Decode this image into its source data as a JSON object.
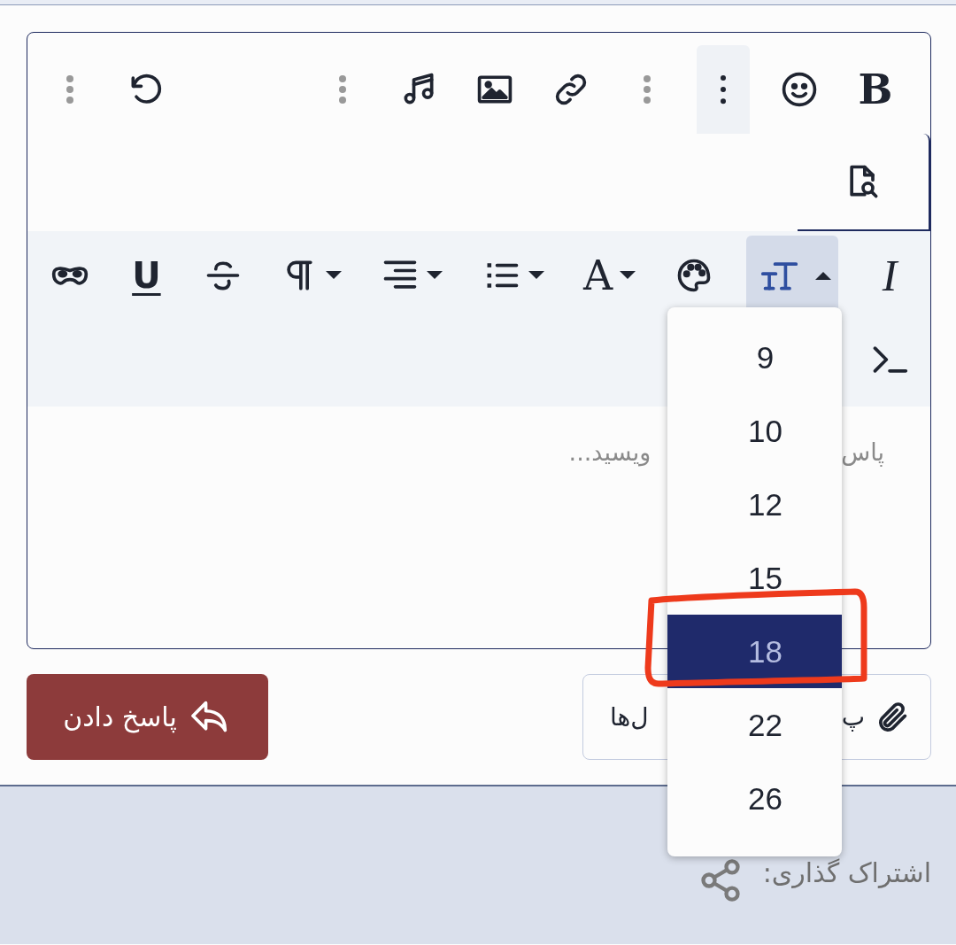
{
  "editor": {
    "toolbar_main": {
      "groups": [
        [
          {
            "kind": "bold",
            "label": "B",
            "selected": false
          },
          {
            "kind": "emoji",
            "selected": false
          },
          {
            "kind": "more",
            "selected": true
          },
          {
            "kind": "separator"
          },
          {
            "kind": "link",
            "selected": false
          },
          {
            "kind": "image",
            "selected": false
          },
          {
            "kind": "audio",
            "selected": false
          },
          {
            "kind": "separator"
          }
        ],
        [
          {
            "kind": "undo",
            "selected": false
          },
          {
            "kind": "separator"
          }
        ]
      ]
    },
    "overflow_row": [
      {
        "kind": "preview",
        "selected": false
      }
    ],
    "format_row": [
      {
        "kind": "italic",
        "label": "I",
        "selected": false
      },
      {
        "kind": "font-size",
        "selected": true,
        "expanded": true
      },
      {
        "kind": "palette",
        "selected": false
      },
      {
        "kind": "text-color",
        "label": "A",
        "selected": false,
        "expanded": false
      },
      {
        "kind": "list",
        "selected": false,
        "expanded": false
      },
      {
        "kind": "align",
        "selected": false,
        "expanded": false
      },
      {
        "kind": "paragraph",
        "selected": false,
        "expanded": false
      },
      {
        "kind": "strike",
        "selected": false
      },
      {
        "kind": "underline",
        "label": "U",
        "selected": false
      },
      {
        "kind": "mask",
        "selected": false
      }
    ],
    "format_row_2": [
      {
        "kind": "terminal",
        "selected": false
      }
    ],
    "placeholder_parts": [
      "پاس",
      "ویسید..."
    ],
    "font_size_menu": [
      {
        "label": "9",
        "selected": false,
        "circled": false
      },
      {
        "label": "10",
        "selected": false,
        "circled": false
      },
      {
        "label": "12",
        "selected": false,
        "circled": false
      },
      {
        "label": "15",
        "selected": false,
        "circled": false
      },
      {
        "label": "18",
        "selected": true,
        "circled": true
      },
      {
        "label": "22",
        "selected": false,
        "circled": false
      },
      {
        "label": "26",
        "selected": false,
        "circled": false
      }
    ]
  },
  "actions": {
    "attach_button": {
      "parts": [
        "پ",
        "ل‌ها"
      ]
    },
    "reply_button": {
      "label": "پاسخ دادن"
    }
  },
  "footer": {
    "share_label": "اشتراک گذاری:"
  }
}
